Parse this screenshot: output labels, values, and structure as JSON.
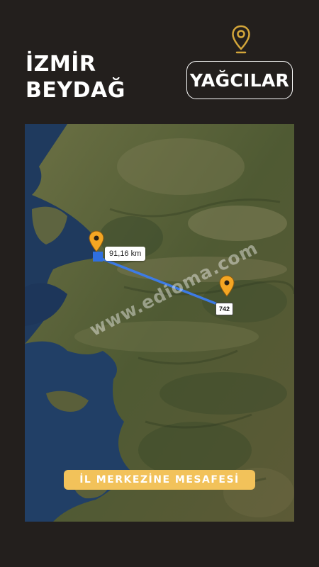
{
  "header": {
    "city": "İZMİR",
    "district": "BEYDAĞ",
    "location_label": "YAĞCILAR",
    "location_icon": "map-pin-icon"
  },
  "map": {
    "distance": "91,16 km",
    "road_number": "742",
    "watermark": "www.edioma.com",
    "banner": "İL MERKEZİNE MESAFESİ",
    "route_color": "#3d7be5",
    "pin_color": "#f4a623",
    "accent_color": "#d4a63a"
  }
}
